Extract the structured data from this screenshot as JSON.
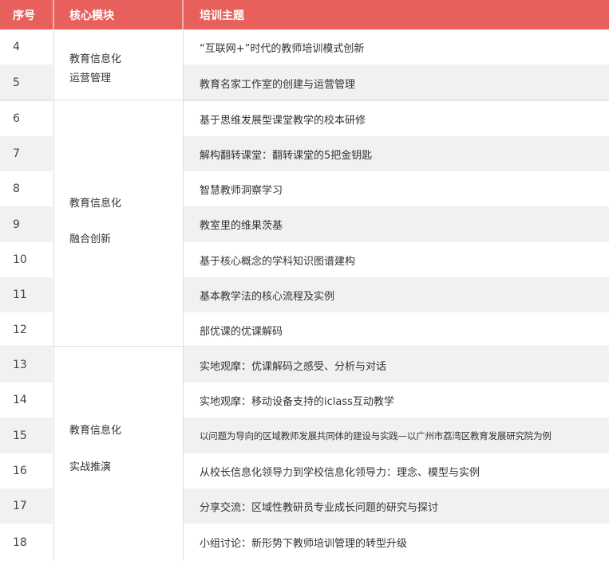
{
  "headers": {
    "seq": "序号",
    "module": "核心模块",
    "topic": "培训主题"
  },
  "modules": [
    {
      "line1": "教育信息化",
      "line2": "运营管理"
    },
    {
      "line1": "教育信息化",
      "line2": "融合创新"
    },
    {
      "line1": "教育信息化",
      "line2": "实战推演"
    }
  ],
  "rows": [
    {
      "num": "4",
      "topic": "“互联网+”时代的教师培训模式创新"
    },
    {
      "num": "5",
      "topic": "教育名家工作室的创建与运营管理"
    },
    {
      "num": "6",
      "topic": "基于思维发展型课堂教学的校本研修"
    },
    {
      "num": "7",
      "topic": "解构翻转课堂：翻转课堂的5把金钥匙"
    },
    {
      "num": "8",
      "topic": "智慧教师洞察学习"
    },
    {
      "num": "9",
      "topic": "教室里的维果茨基"
    },
    {
      "num": "10",
      "topic": "基于核心概念的学科知识图谱建构"
    },
    {
      "num": "11",
      "topic": "基本教学法的核心流程及实例"
    },
    {
      "num": "12",
      "topic": "部优课的优课解码"
    },
    {
      "num": "13",
      "topic": "实地观摩：优课解码之感受、分析与对话"
    },
    {
      "num": "14",
      "topic": "实地观摩：移动设备支持的iclass互动教学"
    },
    {
      "num": "15",
      "topic": "以问题为导向的区域教师发展共同体的建设与实践—以广州市荔湾区教育发展研究院为例"
    },
    {
      "num": "16",
      "topic": "从校长信息化领导力到学校信息化领导力：理念、模型与实例"
    },
    {
      "num": "17",
      "topic": "分享交流：区域性教研员专业成长问题的研究与探讨"
    },
    {
      "num": "18",
      "topic": "小组讨论：新形势下教师培训管理的转型升级"
    }
  ]
}
